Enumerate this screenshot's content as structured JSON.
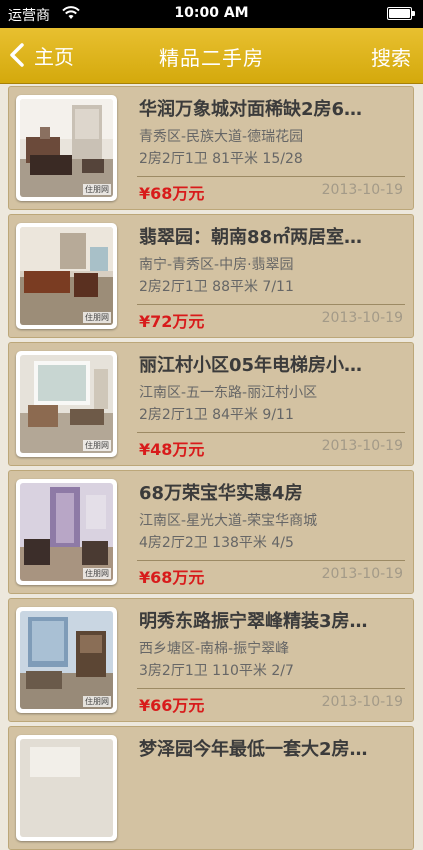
{
  "status_bar": {
    "carrier": "运营商",
    "time": "10:00 AM"
  },
  "nav": {
    "back_label": "主页",
    "title": "精品二手房",
    "search_label": "搜索",
    "bar_color": "#d4a90c"
  },
  "listings": [
    {
      "title": "华润万象城对面稀缺2房6…",
      "location": "青秀区-民族大道-德瑞花园",
      "specs": "2房2厅1卫 81平米 15/28",
      "price": "¥68万元",
      "date": "2013-10-19",
      "watermark": "住朋网"
    },
    {
      "title": "翡翠园：朝南88㎡两居室…",
      "location": "南宁-青秀区-中房·翡翠园",
      "specs": "2房2厅1卫 88平米 7/11",
      "price": "¥72万元",
      "date": "2013-10-19",
      "watermark": "住朋网"
    },
    {
      "title": "丽江村小区05年电梯房小…",
      "location": "江南区-五一东路-丽江村小区",
      "specs": "2房2厅1卫 84平米 9/11",
      "price": "¥48万元",
      "date": "2013-10-19",
      "watermark": "住朋网"
    },
    {
      "title": "68万荣宝华实惠4房",
      "location": "江南区-星光大道-荣宝华商城",
      "specs": "4房2厅2卫 138平米 4/5",
      "price": "¥68万元",
      "date": "2013-10-19",
      "watermark": "住朋网"
    },
    {
      "title": "明秀东路振宁翠峰精装3房…",
      "location": "西乡塘区-南棉-振宁翠峰",
      "specs": "3房2厅1卫 110平米 2/7",
      "price": "¥66万元",
      "date": "2013-10-19",
      "watermark": "住朋网"
    },
    {
      "title": "梦泽园今年最低一套大2房…",
      "location": "",
      "specs": "",
      "price": "",
      "date": "",
      "watermark": ""
    }
  ]
}
